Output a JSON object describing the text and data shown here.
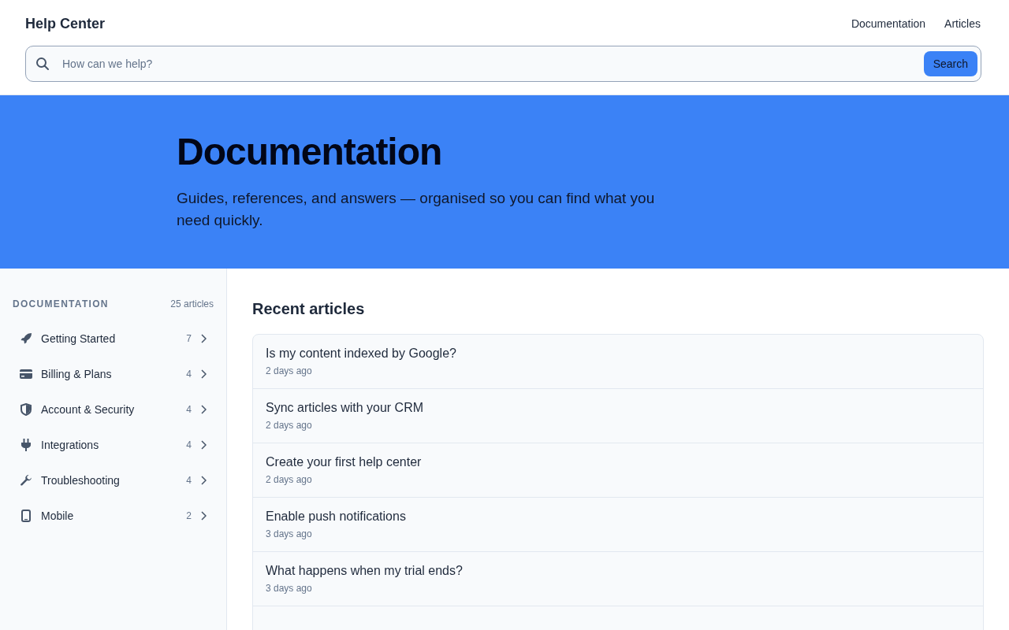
{
  "header": {
    "title": "Help Center",
    "nav": [
      "Documentation",
      "Articles"
    ]
  },
  "search": {
    "placeholder": "How can we help?",
    "button": "Search"
  },
  "hero": {
    "title": "Documentation",
    "subtitle": "Guides, references, and answers — organised so you can find what you need quickly."
  },
  "sidebar": {
    "heading": "DOCUMENTATION",
    "count": "25 articles",
    "items": [
      {
        "label": "Getting Started",
        "count": "7",
        "kind": "rocket"
      },
      {
        "label": "Billing & Plans",
        "count": "4",
        "kind": "card"
      },
      {
        "label": "Account & Security",
        "count": "4",
        "kind": "shield"
      },
      {
        "label": "Integrations",
        "count": "4",
        "kind": "plug"
      },
      {
        "label": "Troubleshooting",
        "count": "4",
        "kind": "wrench"
      },
      {
        "label": "Mobile",
        "count": "2",
        "kind": "phone"
      }
    ]
  },
  "recent": {
    "title": "Recent articles",
    "articles": [
      {
        "title": "Is my content indexed by Google?",
        "time": "2 days ago"
      },
      {
        "title": "Sync articles with your CRM",
        "time": "2 days ago"
      },
      {
        "title": "Create your first help center",
        "time": "2 days ago"
      },
      {
        "title": "Enable push notifications",
        "time": "3 days ago"
      },
      {
        "title": "What happens when my trial ends?",
        "time": "3 days ago"
      }
    ]
  }
}
